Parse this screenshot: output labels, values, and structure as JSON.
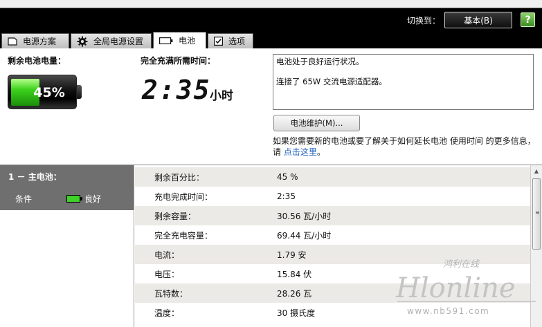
{
  "header": {
    "switch_label": "切换到：",
    "switch_button": "基本(B)",
    "help_label": "?"
  },
  "tabs": [
    {
      "label": "电源方案",
      "icon": "document-icon"
    },
    {
      "label": "全局电源设置",
      "icon": "gear-icon"
    },
    {
      "label": "电池",
      "icon": "battery-icon",
      "active": true
    },
    {
      "label": "选项",
      "icon": "checkbox-icon"
    }
  ],
  "summary": {
    "remaining_label": "剩余电池电量：",
    "remaining_percent": "45%",
    "charge_fraction": 0.45,
    "time_label": "完全充满所需时间：",
    "time_value": "2:35",
    "time_unit": "小时",
    "status_line1": "电池处于良好运行状况。",
    "status_line2": "连接了 65W 交流电源适配器。",
    "maintenance_button": "电池维护(M)...",
    "info_text": "如果您需要新的电池或要了解关于如何延长电池 使用时间 的更多信息，请 ",
    "info_link": "点击这里",
    "info_end": "。"
  },
  "left_pane": {
    "battery_title": "1 － 主电池：",
    "condition_label": "条件",
    "condition_value": "良好"
  },
  "details": [
    {
      "key": "剩余百分比：",
      "value": "45 %"
    },
    {
      "key": "充电完成时间：",
      "value": "2:35"
    },
    {
      "key": "剩余容量：",
      "value": "30.56 瓦/小时"
    },
    {
      "key": "完全充电容量：",
      "value": "69.44 瓦/小时"
    },
    {
      "key": "电流：",
      "value": "1.79 安"
    },
    {
      "key": "电压：",
      "value": "15.84 伏"
    },
    {
      "key": "瓦特数：",
      "value": "28.26 瓦"
    },
    {
      "key": "温度：",
      "value": "30 摄氏度"
    }
  ],
  "watermark": {
    "line1": "鸿利在线",
    "line2": "Hlonline",
    "line3": "www.nb591.com"
  },
  "colors": {
    "header_bg": "#000000",
    "battery_green": "#3cd11d",
    "left_pane_bg": "#6f6f6f",
    "stripe": "#eceae6",
    "link": "#1f5fbf"
  }
}
